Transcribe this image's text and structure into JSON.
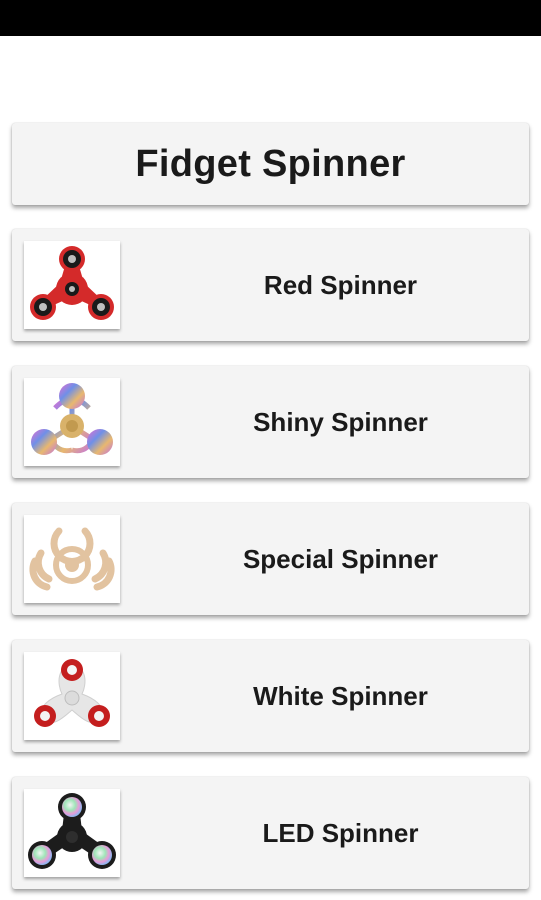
{
  "header": {
    "title": "Fidget Spinner"
  },
  "items": [
    {
      "label": "Red Spinner",
      "icon": "red-spinner-icon",
      "color": "#d42a2a"
    },
    {
      "label": "Shiny Spinner",
      "icon": "shiny-spinner-icon",
      "color": "#9b6fd6"
    },
    {
      "label": "Special Spinner",
      "icon": "special-spinner-icon",
      "color": "#e2c3a0"
    },
    {
      "label": "White Spinner",
      "icon": "white-spinner-icon",
      "color": "#e8e8e8"
    },
    {
      "label": "LED Spinner",
      "icon": "led-spinner-icon",
      "color": "#1c1c1c"
    }
  ]
}
